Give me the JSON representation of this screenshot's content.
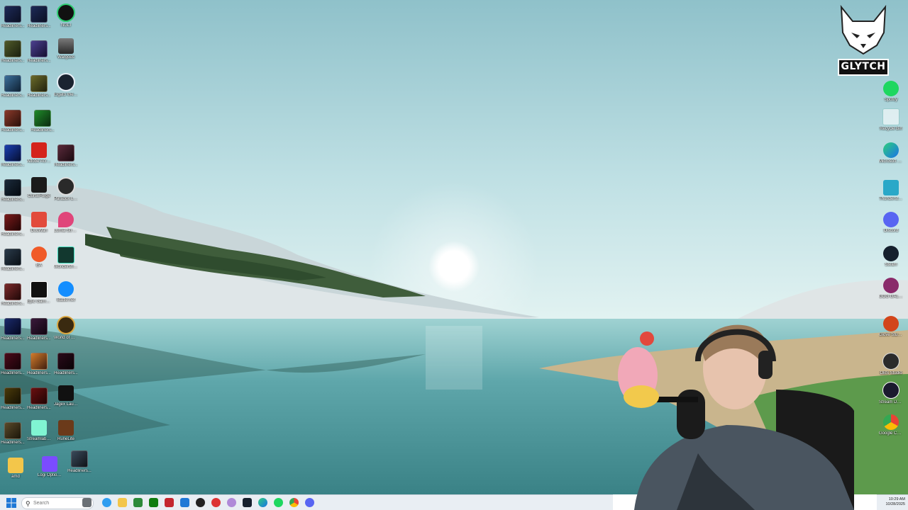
{
  "desktop": {
    "left_icons": [
      {
        "label": "Headliners...",
        "icon": "video-thumbnail"
      },
      {
        "label": "Headliners...",
        "icon": "video-thumbnail"
      },
      {
        "label": "NGLI",
        "icon": "power-app-icon"
      },
      {
        "label": "Headliners...",
        "icon": "video-thumbnail"
      },
      {
        "label": "Headliners...",
        "icon": "video-thumbnail"
      },
      {
        "label": "Wargods",
        "icon": "game-icon"
      },
      {
        "label": "Headliners...",
        "icon": "video-thumbnail"
      },
      {
        "label": "Headliners...",
        "icon": "video-thumbnail"
      },
      {
        "label": "Elgato Webcam",
        "icon": "webcam-icon"
      },
      {
        "label": "Headliners...",
        "icon": "video-thumbnail"
      },
      {
        "label": "Headliners...",
        "icon": "video-thumbnail"
      },
      {
        "label": "Headliners...",
        "icon": "video-thumbnail"
      },
      {
        "label": "Adobe Acrobat",
        "icon": "acrobat-icon"
      },
      {
        "label": "Headliners...",
        "icon": "video-thumbnail"
      },
      {
        "label": "Headliners...",
        "icon": "video-thumbnail"
      },
      {
        "label": "CurseForge",
        "icon": "curseforge-icon"
      },
      {
        "label": "Paradox Launcher v2",
        "icon": "paradox-icon"
      },
      {
        "label": "Headliners...",
        "icon": "video-thumbnail"
      },
      {
        "label": "DouWan",
        "icon": "douwan-icon"
      },
      {
        "label": "Lumia Stream",
        "icon": "lumia-icon"
      },
      {
        "label": "Headliners...",
        "icon": "video-thumbnail"
      },
      {
        "label": "EA",
        "icon": "ea-icon"
      },
      {
        "label": "Wondershare Filmora 14",
        "icon": "filmora-icon"
      },
      {
        "label": "Headliners...",
        "icon": "video-thumbnail"
      },
      {
        "label": "Epic Games Launcher",
        "icon": "epic-games-icon"
      },
      {
        "label": "Battle.net",
        "icon": "battlenet-icon"
      },
      {
        "label": "Headliners...",
        "icon": "video-thumbnail"
      },
      {
        "label": "Headliners...",
        "icon": "video-thumbnail"
      },
      {
        "label": "World of Warcraft",
        "icon": "wow-icon"
      },
      {
        "label": "Headliners...",
        "icon": "video-thumbnail"
      },
      {
        "label": "Headliners...",
        "icon": "video-thumbnail"
      },
      {
        "label": "Headliners...",
        "icon": "video-thumbnail"
      },
      {
        "label": "Headliners...",
        "icon": "video-thumbnail"
      },
      {
        "label": "Headliners...",
        "icon": "video-thumbnail"
      },
      {
        "label": "Jagex Launcher",
        "icon": "jagex-icon"
      },
      {
        "label": "Headliners...",
        "icon": "video-thumbnail"
      },
      {
        "label": "Streamlabs Desktop",
        "icon": "streamlabs-icon"
      },
      {
        "label": "RuneLite",
        "icon": "runelite-icon"
      },
      {
        "label": "amd",
        "icon": "folder-icon"
      },
      {
        "label": "Logi Options+",
        "icon": "logi-icon"
      },
      {
        "label": "Headliners...",
        "icon": "video-thumbnail"
      }
    ],
    "right_icons": [
      {
        "label": "Spotify",
        "icon": "spotify-icon"
      },
      {
        "label": "Recycle Bin",
        "icon": "recycle-bin-icon"
      },
      {
        "label": "Microsoft Edge",
        "icon": "edge-icon"
      },
      {
        "label": "Thunderstore Mod Mana...",
        "icon": "thunderstore-icon"
      },
      {
        "label": "Discord",
        "icon": "discord-icon"
      },
      {
        "label": "Steam",
        "icon": "steam-icon"
      },
      {
        "label": "GOG GALAXY Overlay",
        "icon": "gog-icon"
      },
      {
        "label": "Glove Studio Supplement",
        "icon": "crab-icon"
      },
      {
        "label": "OBS Studio",
        "icon": "obs-icon"
      },
      {
        "label": "Stream Deck",
        "icon": "stream-deck-icon"
      },
      {
        "label": "Google Chrome",
        "icon": "chrome-icon"
      }
    ]
  },
  "logo": {
    "text": "GLYTCH"
  },
  "taskbar": {
    "search_placeholder": "Search",
    "pinned": [
      "file-explorer",
      "photos",
      "xbox",
      "app",
      "calculator",
      "media",
      "app",
      "app",
      "steam",
      "edge",
      "spotify",
      "chrome",
      "discord"
    ],
    "time": "10:29 AM",
    "date": "10/28/2025"
  },
  "colors": {
    "sky_top": "#8fc0c9",
    "sky_horizon": "#d7eef0",
    "water": "#5fa8ad",
    "taskbar": "#e9eef3"
  }
}
